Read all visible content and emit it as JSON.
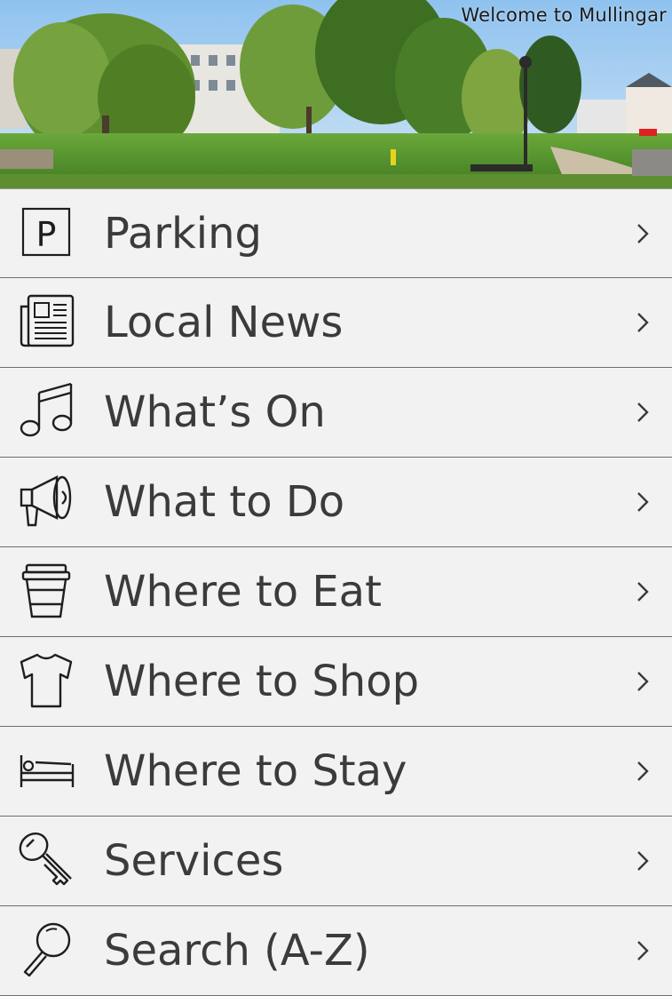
{
  "header": {
    "title": "Welcome to Mullingar",
    "image_description": "park photo"
  },
  "menu": {
    "items": [
      {
        "label": "Parking",
        "icon": "parking-icon"
      },
      {
        "label": "Local News",
        "icon": "newspaper-icon"
      },
      {
        "label": "What’s On",
        "icon": "music-note-icon"
      },
      {
        "label": "What to Do",
        "icon": "megaphone-icon"
      },
      {
        "label": "Where to Eat",
        "icon": "coffee-cup-icon"
      },
      {
        "label": "Where to Shop",
        "icon": "tshirt-icon"
      },
      {
        "label": "Where to Stay",
        "icon": "bed-icon"
      },
      {
        "label": "Services",
        "icon": "key-icon"
      },
      {
        "label": "Search (A-Z)",
        "icon": "search-icon"
      }
    ],
    "chevron_icon": "chevron-right-icon"
  },
  "colors": {
    "background": "#f2f2f2",
    "text": "#3b3b3b",
    "divider": "#6d6d6d"
  }
}
